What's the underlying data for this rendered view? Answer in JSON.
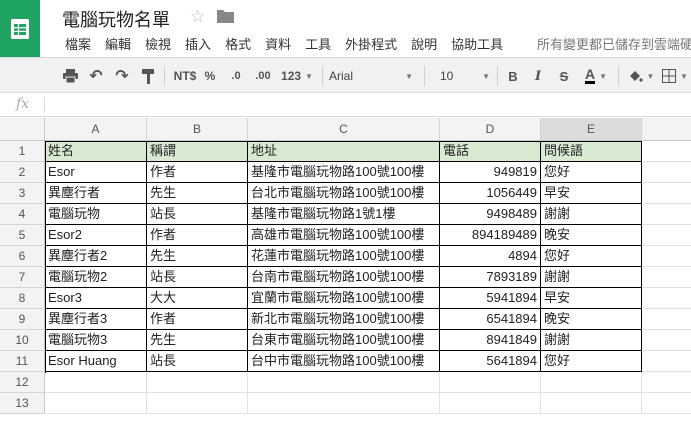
{
  "app": {
    "title": "電腦玩物名單",
    "save_status": "所有變更都已儲存到雲端硬"
  },
  "menu": [
    "檔案",
    "編輯",
    "檢視",
    "插入",
    "格式",
    "資料",
    "工具",
    "外掛程式",
    "說明",
    "協助工具"
  ],
  "toolbar": {
    "currency": "NT$",
    "percent": "%",
    "dec_decrease": ".0",
    "dec_increase": ".00",
    "more_formats": "123",
    "font": "Arial",
    "font_size": "10",
    "bold": "B",
    "italic": "I",
    "strike": "S",
    "text_color": "A"
  },
  "formula_bar": {
    "value": ""
  },
  "sheet": {
    "columns": [
      "A",
      "B",
      "C",
      "D",
      "E"
    ],
    "row_numbers": [
      "1",
      "2",
      "3",
      "4",
      "5",
      "6",
      "7",
      "8",
      "9",
      "10",
      "11",
      "12",
      "13"
    ],
    "header": [
      "姓名",
      "稱謂",
      "地址",
      "電話",
      "問候語"
    ],
    "rows": [
      [
        "Esor",
        "作者",
        "基隆市電腦玩物路100號100樓",
        "949819",
        "您好"
      ],
      [
        "異塵行者",
        "先生",
        "台北市電腦玩物路100號100樓",
        "1056449",
        "早安"
      ],
      [
        "電腦玩物",
        "站長",
        "基隆市電腦玩物路1號1樓",
        "9498489",
        "謝謝"
      ],
      [
        "Esor2",
        "作者",
        "高雄市電腦玩物路100號100樓",
        "894189489",
        "晚安"
      ],
      [
        "異塵行者2",
        "先生",
        "花蓮市電腦玩物路100號100樓",
        "4894",
        "您好"
      ],
      [
        "電腦玩物2",
        "站長",
        "台南市電腦玩物路100號100樓",
        "7893189",
        "謝謝"
      ],
      [
        "Esor3",
        "大大",
        "宜蘭市電腦玩物路100號100樓",
        "5941894",
        "早安"
      ],
      [
        "異塵行者3",
        "作者",
        "新北市電腦玩物路100號100樓",
        "6541894",
        "晚安"
      ],
      [
        "電腦玩物3",
        "先生",
        "台東市電腦玩物路100號100樓",
        "8941849",
        "謝謝"
      ],
      [
        "Esor Huang",
        "站長",
        "台中市電腦玩物路100號100樓",
        "5641894",
        "您好"
      ]
    ]
  },
  "colors": {
    "brand": "#1fa463",
    "header_fill": "#d9ead3",
    "selected_col": "#dcdcdc"
  }
}
